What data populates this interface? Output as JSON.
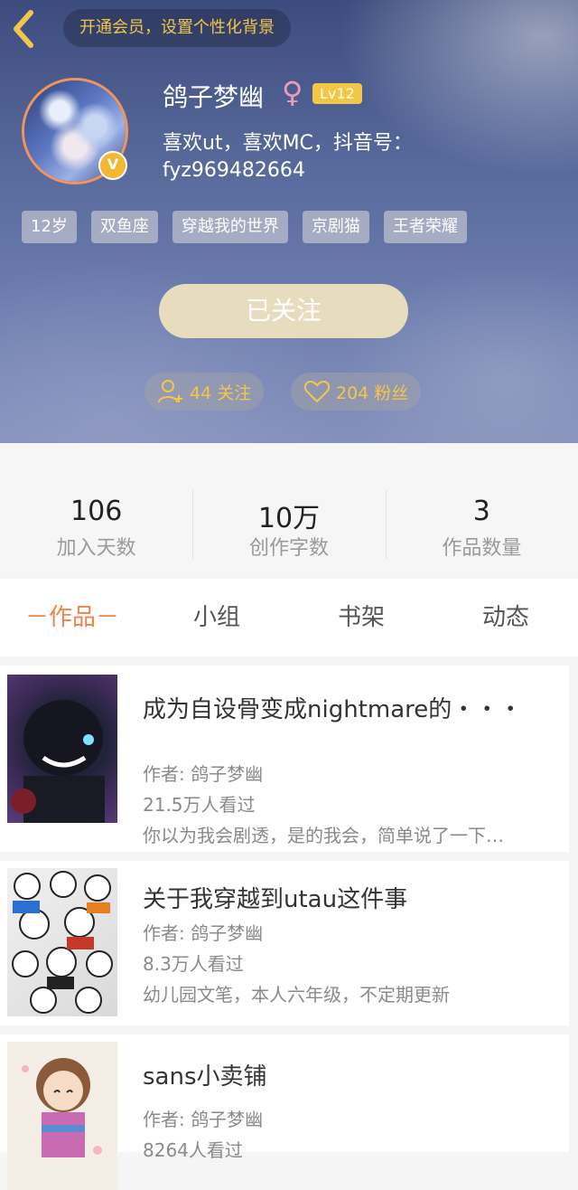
{
  "header": {
    "vip_banner": "开通会员，设置个性化背景",
    "username": "鸽子梦幽",
    "gender_symbol": "♀",
    "level": "Lv12",
    "verified_badge": "V",
    "bio": "喜欢ut，喜欢MC，抖音号：fyz969482664",
    "tags": [
      "12岁",
      "双鱼座",
      "穿越我的世界",
      "京剧猫",
      "王者荣耀"
    ],
    "follow_button": "已关注",
    "following": "44 关注",
    "fans": "204 粉丝"
  },
  "stats": [
    {
      "value": "106",
      "label": "加入天数"
    },
    {
      "value": "10万",
      "label": "创作字数"
    },
    {
      "value": "3",
      "label": "作品数量"
    }
  ],
  "tabs": [
    "－作品－",
    "小组",
    "书架",
    "动态"
  ],
  "works": [
    {
      "title": "成为自设骨变成nightmare的・・・",
      "author": "作者: 鸽子梦幽",
      "views": "21.5万人看过",
      "summary": "你以为我会剧透，是的我会，简单说了一下…"
    },
    {
      "title": "关于我穿越到utau这件事",
      "author": "作者: 鸽子梦幽",
      "views": "8.3万人看过",
      "summary": "幼儿园文笔，本人六年级，不定期更新"
    },
    {
      "title": "sans小卖铺",
      "author": "作者: 鸽子梦幽",
      "views": "8264人看过"
    }
  ],
  "colors": {
    "accent": "#f0834a",
    "gold": "#f3c64a",
    "avatar_ring": "#f3945a"
  }
}
